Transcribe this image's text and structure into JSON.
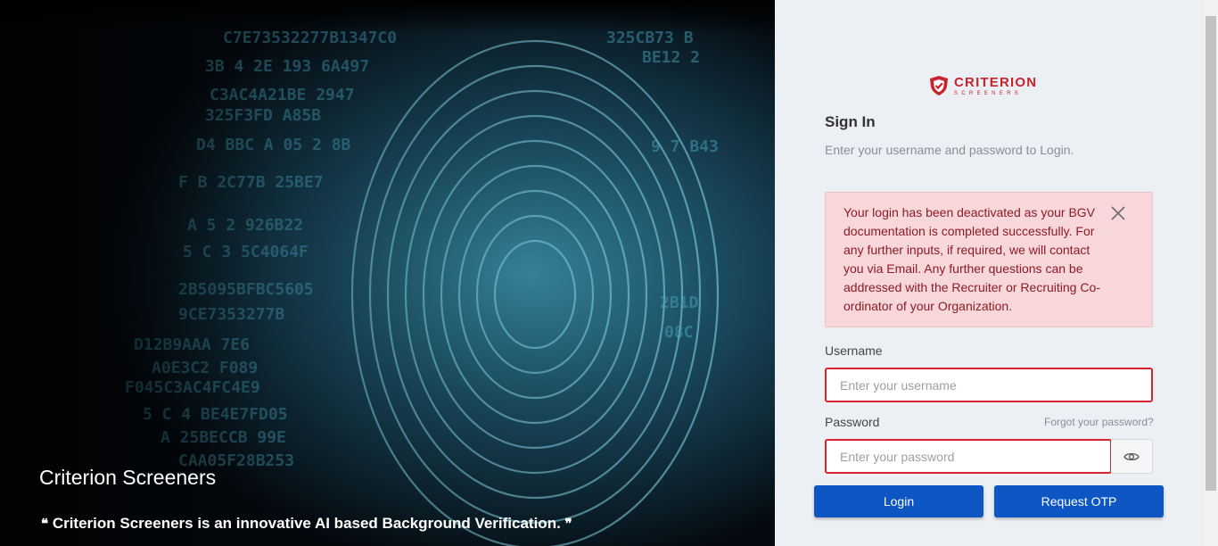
{
  "hero": {
    "title": "Criterion Screeners",
    "quote": "Criterion Screeners is an innovative AI based Background Verification.",
    "quote_open": "❝",
    "quote_close": "❞"
  },
  "logo": {
    "main": "CRITERION",
    "sub": "SCREENERS",
    "icon": "shield-check-icon",
    "color": "#c8232c"
  },
  "signin": {
    "title": "Sign In",
    "subtitle": "Enter your username and password to Login."
  },
  "alert": {
    "message": "Your login has been deactivated as your BGV documentation is completed successfully. For any further inputs, if required, we will contact you via Email. Any further questions can be addressed with the Recruiter or Recruiting Co-ordinator of your Organization.",
    "close_icon": "close-icon",
    "background": "#f8d7da",
    "text_color": "#8b1c26"
  },
  "form": {
    "username_label": "Username",
    "username_placeholder": "Enter your username",
    "username_value": "",
    "password_label": "Password",
    "password_placeholder": "Enter your password",
    "password_value": "",
    "forgot_label": "Forgot your password?",
    "eye_icon": "eye-icon",
    "error_border": "#d9232e"
  },
  "actions": {
    "login_label": "Login",
    "otp_label": "Request OTP",
    "button_color": "#0d56c4"
  }
}
